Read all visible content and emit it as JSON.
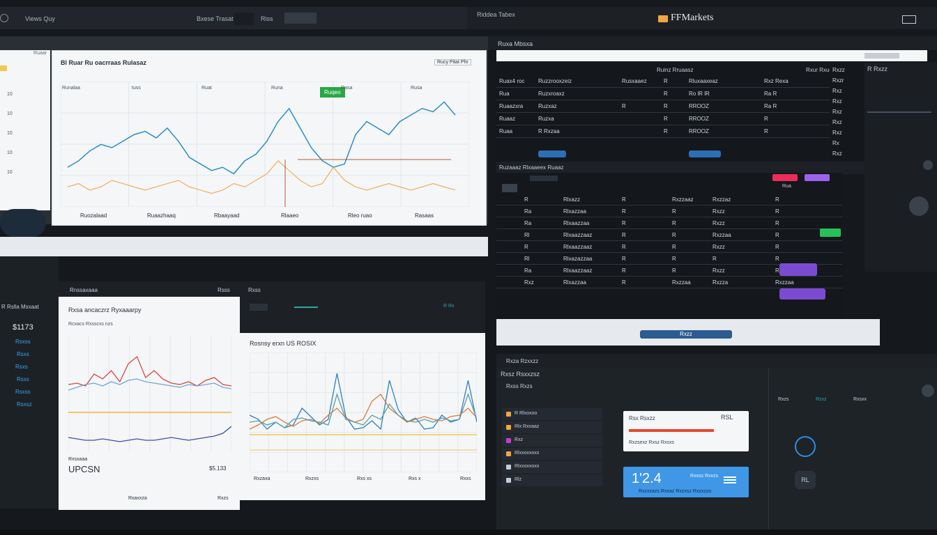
{
  "topbar_left": {
    "title": "Views Quy",
    "center_label": "Bxese Trasat",
    "link1": "Riss"
  },
  "topbar_right": {
    "left_label": "Riddea Tabex",
    "brand": "FFMarkets",
    "icon": "window-icon"
  },
  "main_chart": {
    "tab_label": "Ruaar",
    "header": "Bl Ruar Ru oacrraas Rulasaz",
    "header_right": "Rucy Pitat Phr",
    "green_badge": "Ruqeo",
    "top_labels": [
      "Runalaa",
      "tuss",
      "Ruat",
      "Runa",
      "Rasa",
      "Rusa"
    ],
    "bottom_labels": [
      "Ruozalaad",
      "Ruaazhaaq",
      "Rbaayaad",
      "Rlaaeo",
      "Rleo ruao",
      "Rasaas"
    ],
    "left_sidebar": [
      "10",
      "10",
      "10",
      "10",
      "10"
    ],
    "chart_data": {
      "type": "line",
      "series": [
        {
          "values": [
            10,
            12,
            15,
            17,
            16,
            18,
            20,
            21,
            19,
            22,
            18,
            13,
            11,
            9,
            10,
            8,
            12,
            14,
            18,
            24,
            28,
            22,
            16,
            12,
            10,
            11,
            20,
            24,
            22,
            20,
            24,
            26,
            28,
            27,
            30,
            26
          ]
        },
        {
          "values": [
            4,
            5,
            3,
            4,
            6,
            5,
            4,
            3,
            4,
            5,
            6,
            4,
            3,
            2,
            3,
            5,
            4,
            6,
            8,
            12,
            9,
            6,
            4,
            5,
            10,
            6,
            4,
            3,
            4,
            5,
            4,
            3,
            4,
            5,
            4,
            3
          ]
        }
      ]
    }
  },
  "table_top": {
    "titlebar": "Ruxa Mbsxa",
    "header_left": "Ruinz Rruaasz",
    "header_right": "Rxur   Rxuo",
    "rows": [
      [
        "Ruax4 roc",
        "Ruzzrooxzeiz",
        "Rusxaaez",
        "R",
        "Rluxaaxeaz",
        "Rxz  Rexa"
      ],
      [
        "Rua",
        "Ruzxroaxz",
        "",
        "R",
        "Ro lR lR",
        "Ra  R"
      ],
      [
        "Ruaazxra",
        "Ruzxaz",
        "R",
        "R",
        "RROOZ",
        "Ra  R"
      ],
      [
        "Ruaaz",
        "Ruzxa",
        "",
        "R",
        "RROOZ",
        "R"
      ],
      [
        "Ruaa",
        "R Rxzaa",
        "",
        "R",
        "RROOZ",
        "R"
      ]
    ],
    "right_col": [
      "Rxzz",
      "Rxzr",
      "Rxz",
      "Rxz",
      "Rxz",
      "Rxz",
      "Rxz",
      "Rx",
      "Rxz"
    ]
  },
  "table_mid": {
    "header": "Ruzaaaz  Rlxaaeex  Ruaaz",
    "magenta_btn": "",
    "purple_btn": "",
    "button_label": "Rua",
    "rows": [
      [
        "R",
        "Rlxazz",
        "R",
        "Rxzzaaz",
        "Rxzzaz",
        "R"
      ],
      [
        "Ra",
        "Rlxazzaa",
        "R",
        "R",
        "Rxzz",
        "R"
      ],
      [
        "Ra",
        "Rlxaazzaa",
        "R",
        "R",
        "Rxzz",
        "R"
      ],
      [
        "Rl",
        "Rlxaazzaaz",
        "R",
        "R",
        "Rxzzaa",
        "R"
      ],
      [
        "R",
        "Rlxaazzaaz",
        "R",
        "R",
        "Rxzz",
        "R"
      ],
      [
        "Rl",
        "Rlxazazzaa",
        "R",
        "R",
        "R",
        "R"
      ],
      [
        "Ra",
        "Rlxaazzaaz",
        "R",
        "R",
        "Rxzz",
        "R"
      ],
      [
        "Rxz",
        "Rlxazzaa",
        "R",
        "Rxzzaa",
        "Rxzza",
        "Rxzzaa"
      ]
    ],
    "footer_button": "Rxzz"
  },
  "bottom_left": {
    "sidebar_title": "R Rslla Msxaat",
    "sidebar_value": "$1173",
    "sidebar_items": [
      "Rsxss",
      "Rsxs",
      "Rsxs",
      "Rsxs",
      "Rsxss",
      "Rsxsz"
    ],
    "panel1_title": "Rnssaxaaa",
    "panel1_right": "Rsss",
    "panel1_header": "Rxsa ancaczrz  Ryxaaarpy",
    "panel1_subheader": "Rcxacs  Rxsscxs  nzs",
    "panel1_footer_label": "Rxsxaaa",
    "panel1_footer_value": "UPCSN",
    "panel1_footer_right": "$5.133",
    "panel1_bottom": [
      "Rxaxxza",
      "Rxzs"
    ],
    "panel2_title": "Rxss",
    "panel2_header": "Rosnsy erxn US ROSIX",
    "panel2_bottom": [
      "Rxzaxa",
      "Rxzxs",
      "Rxs xs",
      "Rxs x",
      "Rxxs"
    ]
  },
  "bottom_right": {
    "titlebar": "Rxza Rzxxzz",
    "heading": "Rxsz Rsxxzsz",
    "subheading": "Rxss Rxzs",
    "list": [
      "R Rlxoxoo",
      "Rlx Rxxaaz",
      "Rxz",
      "Rlxxoxxoxx",
      "Rlxxoxxoxx",
      "Rlz"
    ],
    "card_title": "Rsx Rsxzz",
    "card_right": "RSL",
    "card_line": "Rxzsexz  Rxsz  Rxsxs",
    "big_value": "1'2.4",
    "big_label": "Rxxss Rxxzs",
    "big_footer": "Rxzxzazs Rxxaz Rxzxsz Rxzxzzo",
    "right_labels": [
      "Rxzs",
      "Rzxz",
      "Rxsxx"
    ]
  }
}
